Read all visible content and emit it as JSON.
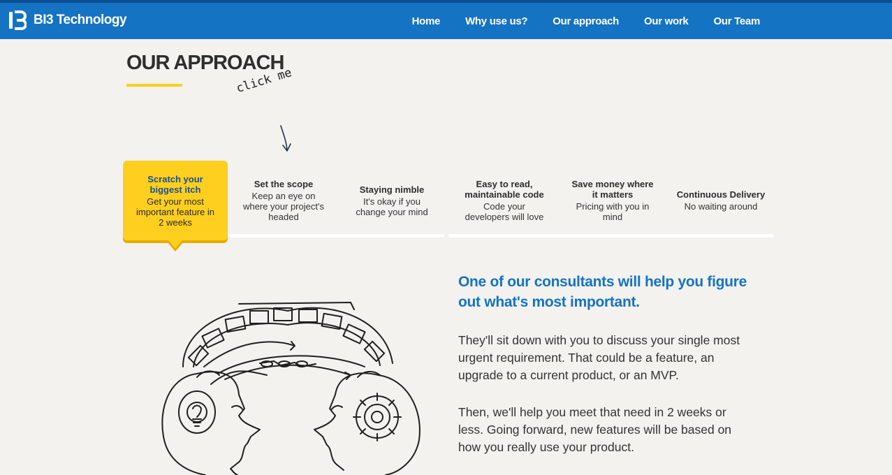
{
  "brand": {
    "name": "BI3 Technology"
  },
  "nav": {
    "items": [
      "Home",
      "Why use us?",
      "Our approach",
      "Our work",
      "Our Team"
    ]
  },
  "section": {
    "title": "OUR APPROACH",
    "hint": "click me"
  },
  "steps": [
    {
      "title": "Scratch your biggest itch",
      "desc": "Get your most important feature in 2 weeks"
    },
    {
      "title": "Set the scope",
      "desc": "Keep an eye on where your project's headed"
    },
    {
      "title": "Staying nimble",
      "desc": "It's okay if you change your mind"
    },
    {
      "title": "Easy to read, maintainable code",
      "desc": "Code your developers will love"
    },
    {
      "title": "Save money where it matters",
      "desc": "Pricing with you in mind"
    },
    {
      "title": "Continuous Delivery",
      "desc": "No waiting around"
    }
  ],
  "content": {
    "lead": "One of our consultants will help you figure out what's most important.",
    "paragraphs": [
      "They'll sit down with you to discuss your single most urgent requirement. That could be a feature, an upgrade to a current product, or an MVP.",
      "Then, we'll help you meet that need in 2 weeks or less. Going forward, new features will be based on how you really use your product."
    ]
  },
  "colors": {
    "brand_blue": "#1573c4",
    "accent_yellow": "#ffcf1f"
  },
  "icons": {
    "logo": "b3-logo-icon",
    "hint_arrow": "arrow-down-icon",
    "illustration": "heads-connected-illustration"
  }
}
